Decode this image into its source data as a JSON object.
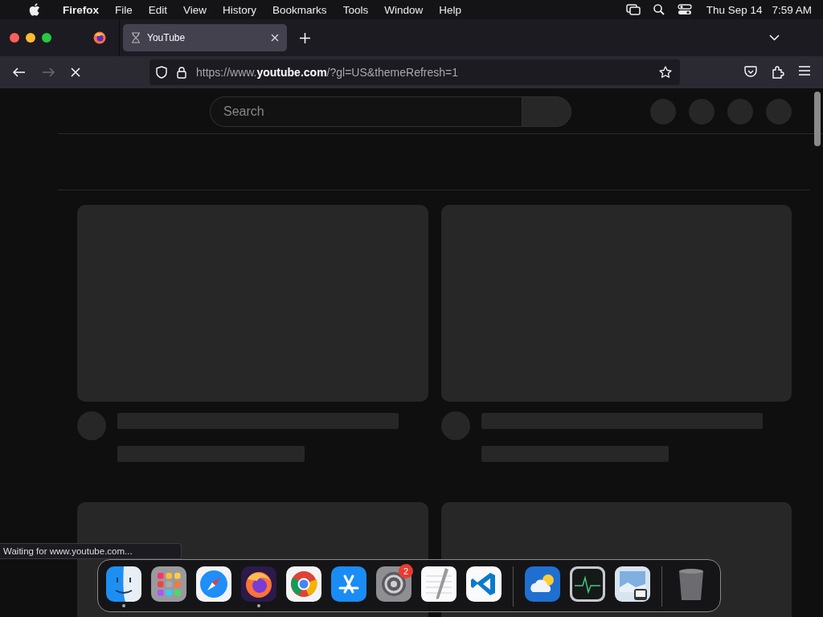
{
  "menu_bar": {
    "app": "Firefox",
    "items": [
      "File",
      "Edit",
      "View",
      "History",
      "Bookmarks",
      "Tools",
      "Window",
      "Help"
    ],
    "date": "Thu Sep 14",
    "time": "7:59 AM"
  },
  "tabs": [
    {
      "title": "YouTube",
      "selected": true,
      "loading": true
    }
  ],
  "toolbar": {
    "url": "https://www.**youtube.com**/?gl=US&themeRefresh=1",
    "loading": true,
    "forward_disabled": true
  },
  "page": {
    "search": {
      "placeholder": "Search"
    }
  },
  "status": "Waiting for www.youtube.com...",
  "dock": {
    "apps": [
      {
        "kind": "finder",
        "running": true
      },
      {
        "kind": "launchpad",
        "running": false
      },
      {
        "kind": "safari",
        "running": false
      },
      {
        "kind": "firefox",
        "running": true
      },
      {
        "kind": "chrome",
        "running": false
      },
      {
        "kind": "appstore",
        "running": false
      },
      {
        "kind": "settings",
        "running": false,
        "badge": "2"
      },
      {
        "kind": "textedit",
        "running": false
      },
      {
        "kind": "vscode",
        "running": false
      }
    ],
    "utilities": [
      {
        "kind": "weather",
        "running": false
      },
      {
        "kind": "monitor",
        "running": false
      },
      {
        "kind": "preview",
        "running": false
      }
    ],
    "trash": {
      "kind": "trash",
      "running": false
    }
  }
}
